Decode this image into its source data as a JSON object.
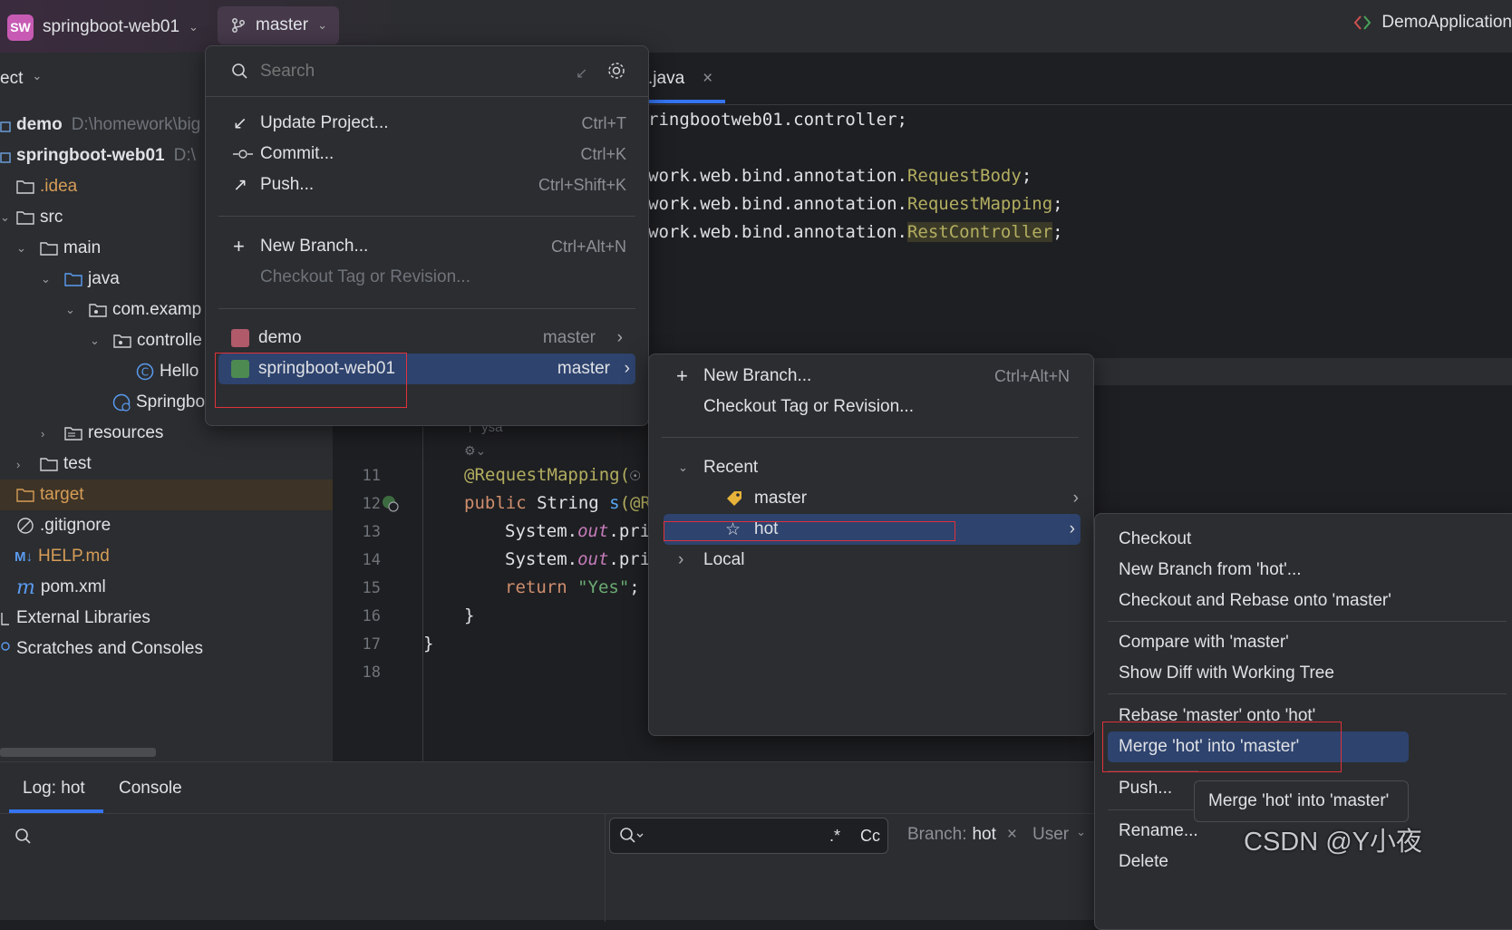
{
  "titlebar": {
    "project_badge": "SW",
    "project_name": "springboot-web01",
    "branch": "master",
    "run_config": "DemoApplication"
  },
  "project_panel": {
    "header": "ect",
    "items": [
      {
        "label": "demo",
        "path": "D:\\homework\\big",
        "bold": true
      },
      {
        "label": "springboot-web01",
        "path": "D:\\",
        "bold": true
      },
      {
        "label": ".idea"
      },
      {
        "label": "src"
      },
      {
        "label": "main"
      },
      {
        "label": "java"
      },
      {
        "label": "com.examp"
      },
      {
        "label": "controlle"
      },
      {
        "label": "Hello"
      },
      {
        "label": "Springbo"
      },
      {
        "label": "resources"
      },
      {
        "label": "test"
      },
      {
        "label": "target"
      },
      {
        "label": ".gitignore"
      },
      {
        "label": "HELP.md"
      },
      {
        "label": "pom.xml"
      },
      {
        "label": "External Libraries"
      },
      {
        "label": "Scratches and Consoles"
      }
    ]
  },
  "editor": {
    "tab": ".java",
    "code_top": [
      {
        "plain": "ringbootweb01.controller;",
        "ann": ""
      },
      {
        "plain": "work.web.bind.annotation.",
        "ann": "RequestBody"
      },
      {
        "plain": "work.web.bind.annotation.",
        "ann": "RequestMapping"
      },
      {
        "plain": "work.web.bind.annotation.",
        "ann": "RestController"
      }
    ],
    "author": "ysa",
    "line_numbers": [
      "11",
      "12",
      "13",
      "14",
      "15",
      "16",
      "17",
      "18"
    ],
    "code": {
      "l11": "@RequestMapping(",
      "l12_kw": "public ",
      "l12_type": "String ",
      "l12_fn": "s",
      "l12_rest": "(@R",
      "l13_a": "System.",
      "l13_b": "out",
      "l13_c": ".pri",
      "l14_a": "System.",
      "l14_b": "out",
      "l14_c": ".pri",
      "l15_kw": "return ",
      "l15_str": "\"Yes\"",
      "l15_end": ";",
      "l16": "}",
      "l17": "}"
    }
  },
  "git_menu": {
    "search_placeholder": "Search",
    "update": "Update Project...",
    "update_sc": "Ctrl+T",
    "commit": "Commit...",
    "commit_sc": "Ctrl+K",
    "push": "Push...",
    "push_sc": "Ctrl+Shift+K",
    "new_branch": "New Branch...",
    "new_branch_sc": "Ctrl+Alt+N",
    "checkout_tag": "Checkout Tag or Revision...",
    "repos": [
      {
        "name": "demo",
        "branch": "master",
        "color": "#b05a6a"
      },
      {
        "name": "springboot-web01",
        "branch": "master",
        "color": "#4c8a52"
      }
    ]
  },
  "branch_menu": {
    "new_branch": "New Branch...",
    "new_branch_sc": "Ctrl+Alt+N",
    "checkout_tag": "Checkout Tag or Revision...",
    "recent": "Recent",
    "master": "master",
    "hot": "hot",
    "local": "Local"
  },
  "actions_menu": {
    "checkout": "Checkout",
    "new_from": "New Branch from 'hot'...",
    "checkout_rebase": "Checkout and Rebase onto 'master'",
    "compare": "Compare with 'master'",
    "show_diff": "Show Diff with Working Tree",
    "rebase": "Rebase 'master' onto 'hot'",
    "merge": "Merge 'hot' into 'master'",
    "push": "Push...",
    "rename": "Rename...",
    "delete": "Delete"
  },
  "tooltip": "Merge 'hot' into 'master'",
  "bottom": {
    "tab_log": "Log: hot",
    "tab_console": "Console",
    "filter_regex": ".*",
    "filter_case": "Cc",
    "branch_label": "Branch:",
    "branch_value": "hot",
    "user_label": "User"
  },
  "watermark": "CSDN @Y小夜",
  "colors": {
    "selection": "#2e436e",
    "annotation": "#b3ae60",
    "keyword": "#cf8e6d",
    "string": "#6aab73",
    "highlight_red": "#e0323a"
  }
}
